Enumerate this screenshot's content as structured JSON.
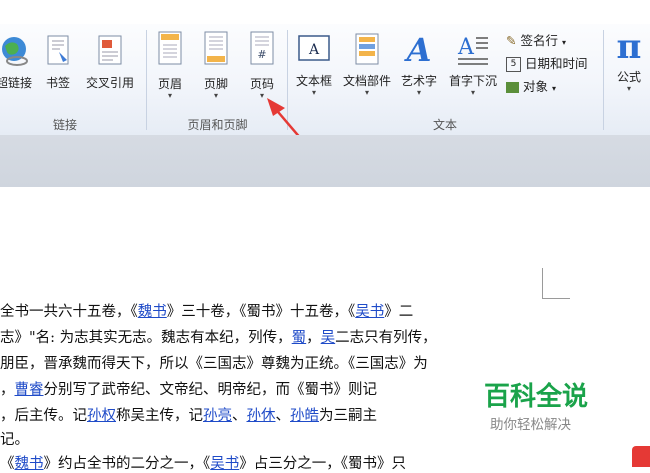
{
  "ribbon": {
    "buttons": {
      "hyperlink": "超链接",
      "bookmark": "书签",
      "cross_ref": "交叉引用",
      "header": "页眉",
      "footer": "页脚",
      "page_number": "页码",
      "textbox": "文本框",
      "quick_parts": "文档部件",
      "wordart": "艺术字",
      "dropcap": "首字下沉",
      "signature": "签名行",
      "datetime": "日期和时间",
      "object": "对象",
      "equation": "公式",
      "pi_symbol": "π"
    },
    "groups": {
      "links": "链接",
      "header_footer": "页眉和页脚",
      "text": "文本"
    }
  },
  "document": {
    "lines": [
      [
        "全书一共六十五卷，《",
        {
          "link": "魏书"
        },
        "》三十卷，《蜀书》十五卷，《",
        {
          "link": "吴书"
        },
        "》二"
      ],
      [
        "志》\"名: 为志其实无志。魏志有本纪，列传，",
        {
          "link": "蜀"
        },
        "，",
        {
          "link": "吴"
        },
        "二志只有列传，"
      ],
      [
        "朋臣，晋承魏而得天下，所以《三国志》尊魏为正统。《三国志》为"
      ],
      [
        "，",
        {
          "link": "曹睿"
        },
        "分别写了武帝纪、文帝纪、明帝纪，而《蜀书》则记"
      ],
      [
        "，后主传。记",
        {
          "link": "孙权"
        },
        "称吴主传，记",
        {
          "link": "孙亮"
        },
        "、",
        {
          "link": "孙休"
        },
        "、",
        {
          "link": "孙皓"
        },
        "为三嗣主"
      ],
      [
        "记。"
      ],
      [
        "《",
        {
          "link": "魏书"
        },
        "》约占全书的二分之一，《",
        {
          "link": "吴书"
        },
        "》占三分之一，《蜀书》只"
      ]
    ]
  },
  "watermark": {
    "title": "百科全说",
    "subtitle": "助你轻松解决"
  },
  "colors": {
    "link": "#1f4bc8",
    "watermark_green": "#1aa34a",
    "annotation_arrow": "#e53935"
  }
}
